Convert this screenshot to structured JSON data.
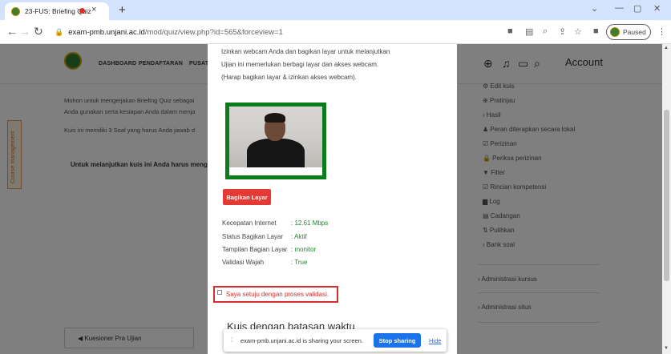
{
  "browser": {
    "tab_title": "23-FUS: Briefing Quiz",
    "tab_close": "×",
    "new_tab": "+",
    "url_host": "exam-pmb.unjani.ac.id",
    "url_path": "/mod/quiz/view.php?id=565&forceview=1",
    "profile_status": "Paused",
    "window_controls": [
      "⌄",
      "—",
      "▢",
      "✕"
    ]
  },
  "site_nav": {
    "links": [
      "DASHBOARD",
      "PENDAFTARAN",
      "PUSAT"
    ],
    "account_label": "Account"
  },
  "page": {
    "para1_line1": "Mohon untuk mengerjakan Briefing Quiz sebagai",
    "para1_line2": "Anda gunakan serta kesiapan Anda dalam menja",
    "para2": "Kuis ini memiliki 3 Soal yang harus Anda jawab d",
    "bold_line": "Untuk melanjutkan kuis ini Anda harus meng",
    "course_management": "Course management",
    "kuesioner_button": "◀ Kuesioner Pra Ujian"
  },
  "admin_menu": {
    "items": [
      "⚙ Edit kuis",
      "⊕ Pratinjau",
      "› Hasil",
      "♟ Peran diterapkan secara lokal",
      "☑ Perizinan",
      "🔒 Periksa perizinan",
      "▼ Filter",
      "☑ Rincian kompetensi",
      "▆ Log",
      "▤ Cadangan",
      "⇅ Pulihkan",
      "› Bank soal"
    ],
    "admin_kursus": "› Administrasi kursus",
    "admin_situs": "› Administrasi situs"
  },
  "modal": {
    "intro_line1": "Izinkan webcam Anda dan bagikan layar untuk melanjutkan",
    "intro_line2": "Ujian ini memerlukan berbagi layar dan akses webcam.",
    "intro_line3": "(Harap bagikan layar & izinkan akses webcam).",
    "share_button": "Bagikan Layar",
    "stats": [
      {
        "label": "Kecepatan Internet",
        "value": ": 12.61 Mbps"
      },
      {
        "label": "Status Bagikan Layar",
        "value": ": Aktif"
      },
      {
        "label": "Tampilan Bagian Layar",
        "value": ": monitor"
      },
      {
        "label": "Validasi Wajah",
        "value": ": True"
      }
    ],
    "consent_label": "Saya setuju dengan proses validasi.",
    "section_title": "Kuis dengan batasan waktu"
  },
  "sharebar": {
    "message": "exam-pmb.unjani.ac.id is sharing your screen.",
    "stop_label": "Stop sharing",
    "hide_label": "Hide"
  },
  "colors": {
    "accent": "#0a7d1a",
    "danger": "#e53935",
    "link": "#1a73e8"
  }
}
